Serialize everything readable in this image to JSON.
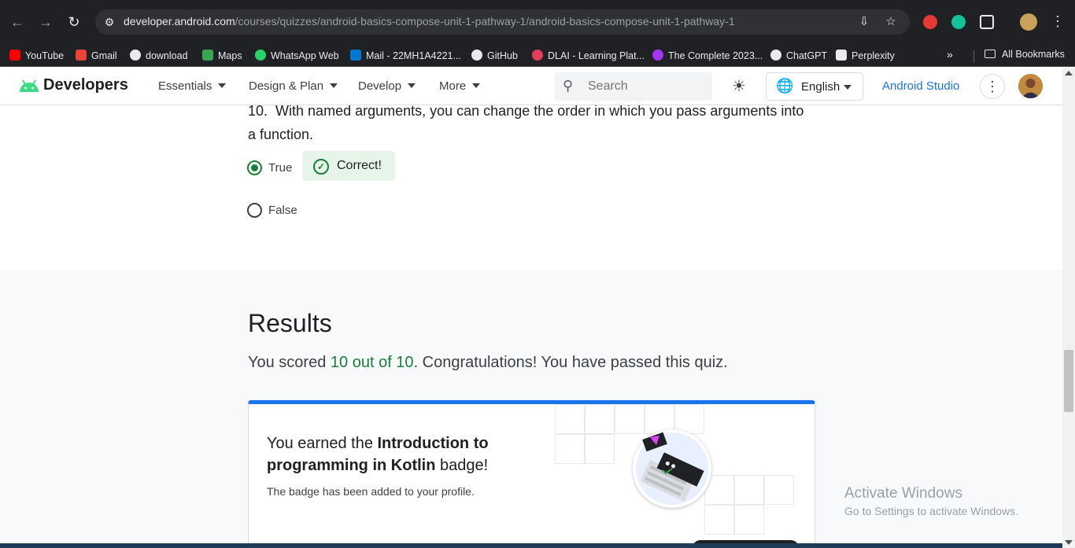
{
  "browser": {
    "url_host": "developer.android.com",
    "url_path": "/courses/quizzes/android-basics-compose-unit-1-pathway-1/android-basics-compose-unit-1-pathway-1",
    "bookmarks": [
      {
        "label": "YouTube",
        "color": "#ff0000"
      },
      {
        "label": "Gmail",
        "color": "#ea4335"
      },
      {
        "label": "download",
        "color": "#e8eaed"
      },
      {
        "label": "Maps",
        "color": "#34a853"
      },
      {
        "label": "WhatsApp Web",
        "color": "#25d366"
      },
      {
        "label": "Mail - 22MH1A4221...",
        "color": "#0078d4"
      },
      {
        "label": "GitHub",
        "color": "#e8eaed"
      },
      {
        "label": "DLAI - Learning Plat...",
        "color": "#e03e5c"
      },
      {
        "label": "The Complete 2023...",
        "color": "#a435f0"
      },
      {
        "label": "ChatGPT",
        "color": "#e8eaed"
      },
      {
        "label": "Perplexity",
        "color": "#e8eaed"
      }
    ],
    "all_bookmarks": "All Bookmarks"
  },
  "header": {
    "logo": "Developers",
    "menu": [
      "Essentials",
      "Design & Plan",
      "Develop",
      "More"
    ],
    "search_placeholder": "Search",
    "language": "English",
    "android_studio": "Android Studio"
  },
  "question": {
    "number": "10.",
    "text": "With named arguments, you can change the order in which you pass arguments into a function.",
    "options": [
      {
        "label": "True",
        "selected": true
      },
      {
        "label": "False",
        "selected": false
      }
    ],
    "feedback": "Correct!"
  },
  "results": {
    "title": "Results",
    "score_prefix": "You scored ",
    "score_value": "10 out of 10",
    "score_suffix": ". Congratulations! You have passed this quiz.",
    "badge_prefix": "You earned the ",
    "badge_name": "Introduction to programming in Kotlin",
    "badge_suffix": " badge!",
    "badge_note": "The badge has been added to your profile."
  },
  "watermark": {
    "line1": "Activate Windows",
    "line2": "Go to Settings to activate Windows."
  }
}
